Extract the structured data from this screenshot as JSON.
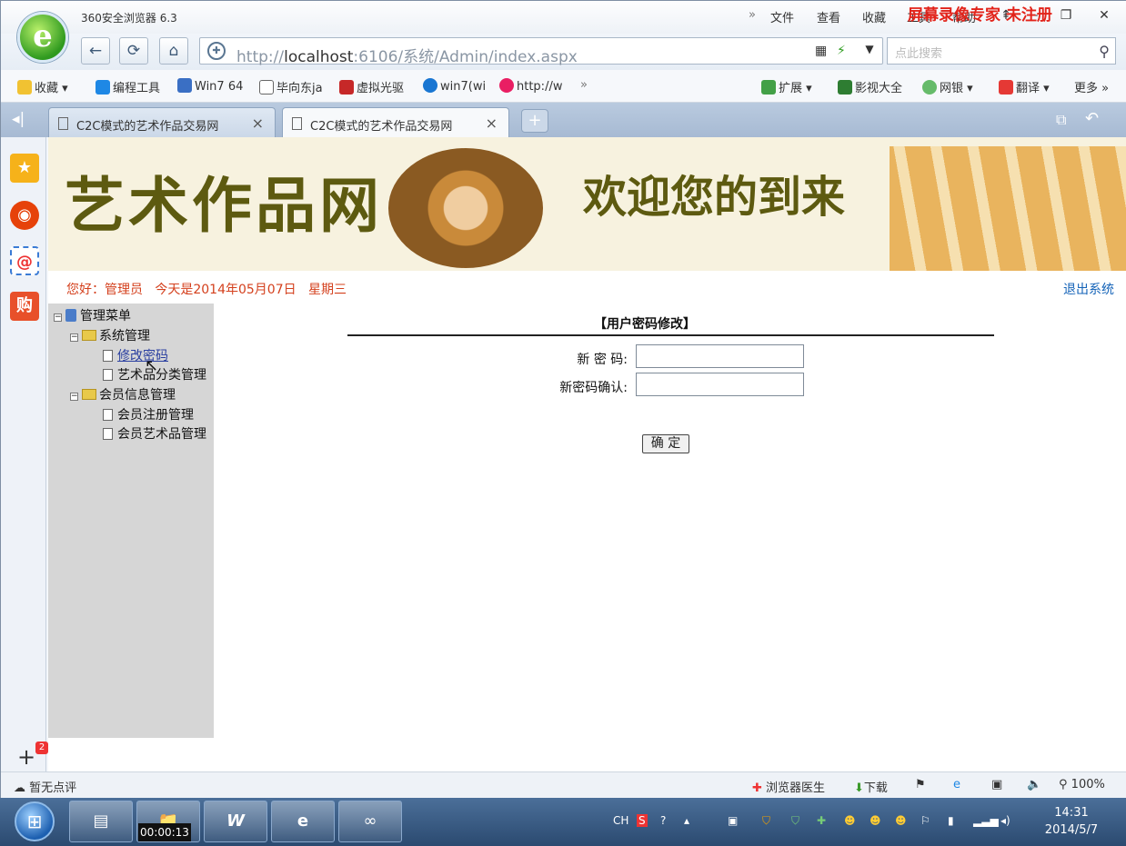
{
  "app": {
    "title": "360安全浏览器 6.3"
  },
  "menu": [
    "文件",
    "查看",
    "收藏",
    "工具",
    "帮助"
  ],
  "address": {
    "url_prefix": "http://",
    "url_host": "localhost",
    "url_rest": ":6106/系统/Admin/index.aspx"
  },
  "search": {
    "placeholder": "点此搜索"
  },
  "watermark": "屏幕录像专家 未注册",
  "favorites": {
    "left": [
      "收藏",
      "编程工具",
      "Win7 64",
      "毕向东ja",
      "虚拟光驱",
      "win7(wi",
      "http://w"
    ],
    "right": [
      "扩展",
      "影视大全",
      "网银",
      "翻译",
      "更多"
    ]
  },
  "tabs": [
    "C2C模式的艺术作品交易网",
    "C2C模式的艺术作品交易网"
  ],
  "banner": {
    "title": "艺术作品网",
    "welcome": "欢迎您的到来"
  },
  "header": {
    "greeting": "您好：管理员",
    "date_text": "今天是2014年05月07日",
    "weekday": "星期三",
    "logout": "退出系统"
  },
  "tree": {
    "root": "管理菜单",
    "groups": [
      {
        "label": "系统管理",
        "items": [
          "修改密码",
          "艺术品分类管理"
        ]
      },
      {
        "label": "会员信息管理",
        "items": [
          "会员注册管理",
          "会员艺术品管理"
        ]
      }
    ]
  },
  "form": {
    "title": "【用户密码修改】",
    "new_password_label": "新 密 码:",
    "confirm_label": "新密码确认:",
    "new_password_value": "",
    "confirm_value": "",
    "submit": "确 定"
  },
  "sidebar": {
    "badge": "2"
  },
  "status": {
    "comment": "暂无点评",
    "doctor": "浏览器医生",
    "download": "下载",
    "zoom": "100%"
  },
  "taskbar": {
    "recording": "00:00:13",
    "lang": "CH",
    "time": "14:31",
    "date": "2014/5/7"
  },
  "colors": {
    "accent_red": "#d4401d",
    "link_blue": "#1463b8",
    "banner_text": "#5d5a10",
    "menu_bg": "#d6d6d6"
  }
}
